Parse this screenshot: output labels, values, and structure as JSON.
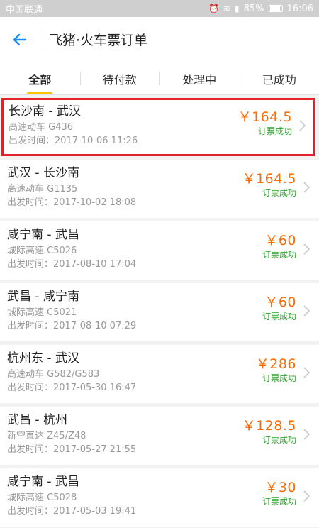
{
  "status_bar": {
    "carrier": "中国联通",
    "battery": "85%",
    "time": "16:06",
    "icons": [
      "alarm-icon",
      "wifi-icon",
      "signal-icon",
      "battery-icon"
    ]
  },
  "header": {
    "title": "飞猪·火车票订单",
    "back_icon": "back-arrow-icon"
  },
  "tabs": [
    {
      "label": "全部",
      "active": true
    },
    {
      "label": "待付款",
      "active": false
    },
    {
      "label": "处理中",
      "active": false
    },
    {
      "label": "已成功",
      "active": false
    }
  ],
  "orders": [
    {
      "route": "长沙南 - 武汉",
      "train": "高速动车  G436",
      "depart": "出发时间：2017-10-06 11:26",
      "price": "￥164.5",
      "status": "订票成功",
      "highlighted": true
    },
    {
      "route": "武汉 - 长沙南",
      "train": "高速动车  G1135",
      "depart": "出发时间：2017-10-02 18:08",
      "price": "￥164.5",
      "status": "订票成功",
      "highlighted": false
    },
    {
      "route": "咸宁南 - 武昌",
      "train": "城际高速  C5026",
      "depart": "出发时间：2017-08-10 17:04",
      "price": "￥60",
      "status": "订票成功",
      "highlighted": false
    },
    {
      "route": "武昌 - 咸宁南",
      "train": "城际高速  C5021",
      "depart": "出发时间：2017-08-10 07:29",
      "price": "￥60",
      "status": "订票成功",
      "highlighted": false
    },
    {
      "route": "杭州东 - 武汉",
      "train": "高速动车  G582/G583",
      "depart": "出发时间：2017-05-30 16:47",
      "price": "￥286",
      "status": "订票成功",
      "highlighted": false
    },
    {
      "route": "武昌 - 杭州",
      "train": "新空直达  Z45/Z48",
      "depart": "出发时间：2017-05-27 21:55",
      "price": "￥128.5",
      "status": "订票成功",
      "highlighted": false
    },
    {
      "route": "咸宁南 - 武昌",
      "train": "城际高速  C5028",
      "depart": "出发时间：2017-05-03 19:41",
      "price": "￥30",
      "status": "订票成功",
      "highlighted": false
    }
  ],
  "colors": {
    "accent": "#ffc300",
    "price": "#ff6a00",
    "success": "#2fa52f",
    "back_arrow": "#1a8cff",
    "highlight_border": "#e0202a"
  }
}
